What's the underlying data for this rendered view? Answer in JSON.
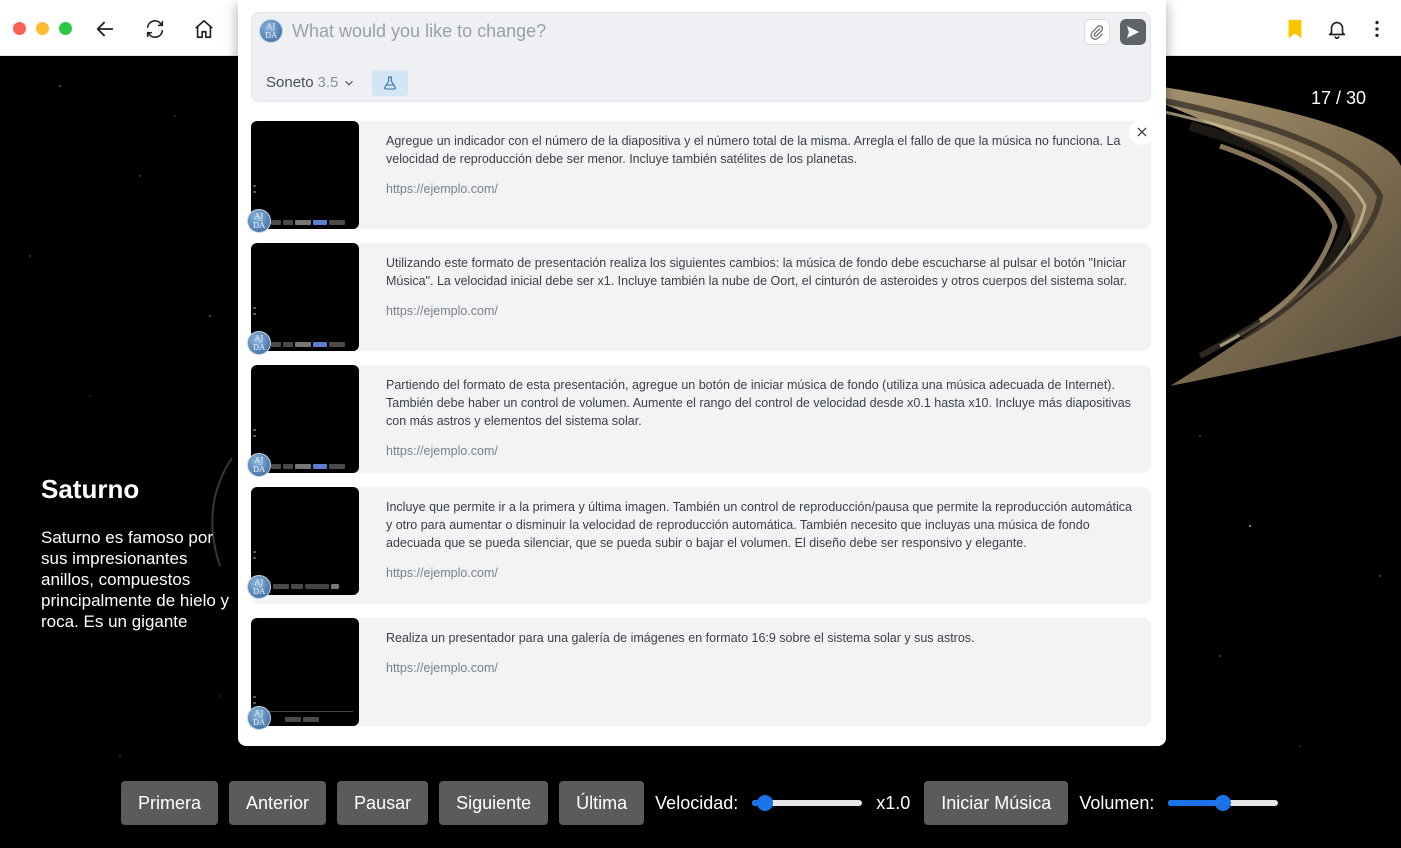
{
  "browser": {
    "back_icon": "arrow-left-icon",
    "reload_icon": "reload-icon",
    "home_icon": "home-icon",
    "bookmark_color": "#f9c400"
  },
  "slide": {
    "counter": "17 / 30",
    "title": "Saturno",
    "description": "Saturno es famoso por sus impresionantes anillos, compuestos principalmente de hielo y roca. Es un gigante gaseoso con una densidad menor que la del agua."
  },
  "controls": {
    "first": "Primera",
    "previous": "Anterior",
    "pause": "Pausar",
    "next": "Siguiente",
    "last": "Última",
    "speed_label": "Velocidad:",
    "speed_value": "x1.0",
    "speed_level": 0.05,
    "music": "Iniciar Música",
    "volume_label": "Volumen:",
    "volume_level": 0.5
  },
  "prompt": {
    "placeholder": "What would you like to change?",
    "model_name": "Soneto",
    "model_version": "3.5",
    "avatar_text": "AJ DA"
  },
  "history": [
    {
      "text": "Agregue un indicador con el número de la diapositiva y el número total de la misma. Arregla el fallo de que la música no funciona. La velocidad de reproducción debe ser menor. Incluye también satélites de los planetas.",
      "url": "https://ejemplo.com/"
    },
    {
      "text": "Utilizando este formato de presentación realiza los siguientes cambios: la música de fondo debe escucharse al pulsar el botón \"Iniciar Música\". La velocidad inicial debe ser x1. Incluye también la nube de Oort, el cinturón de asteroides y otros cuerpos del sistema solar.",
      "url": "https://ejemplo.com/"
    },
    {
      "text": "Partiendo del formato de esta presentación, agregue un botón de iniciar música de fondo (utiliza una música adecuada de Internet). También debe haber un control de volumen. Aumente el rango del control de velocidad desde x0.1 hasta x10. Incluye más diapositivas con más astros y elementos del sistema solar.",
      "url": "https://ejemplo.com/"
    },
    {
      "text": "Incluye que permite ir a la primera y última imagen. También un control de reproducción/pausa que permite la reproducción automática y otro para aumentar o disminuir la velocidad de reproducción automática. También necesito que incluyas una música de fondo adecuada que se pueda silenciar, que se pueda subir o bajar el volumen. El diseño debe ser responsivo y elegante.",
      "url": "https://ejemplo.com/"
    },
    {
      "text": "Realiza un presentador para una galería de imágenes en formato 16:9 sobre el sistema solar y sus astros.",
      "url": "https://ejemplo.com/"
    }
  ]
}
